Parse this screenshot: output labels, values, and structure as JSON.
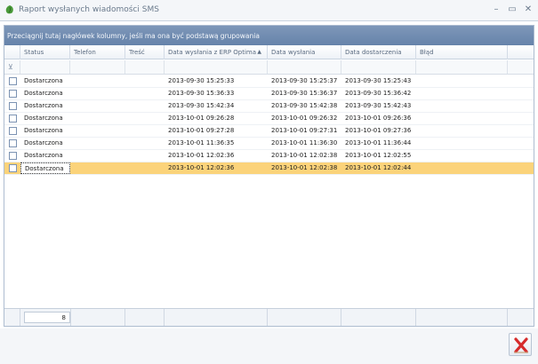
{
  "window": {
    "title": "Raport wysłanych wiadomości SMS",
    "minimize_glyph": "–",
    "maximize_glyph": "▭",
    "close_glyph": "✕"
  },
  "group_panel": {
    "text": "Przeciągnij tutaj nagłówek kolumny, jeśli ma ona być podstawą grupowania"
  },
  "columns": [
    {
      "label": "Status"
    },
    {
      "label": "Telefon"
    },
    {
      "label": "Treść"
    },
    {
      "label": "Data wysłania z ERP Optima"
    },
    {
      "label": "Data wysłania"
    },
    {
      "label": "Data dostarczenia"
    },
    {
      "label": "Błąd"
    }
  ],
  "sort_indicator": "▲",
  "filter_icon": "funnel-icon",
  "rows": [
    {
      "status": "Dostarczona",
      "telefon": "",
      "tresc": "",
      "erp": "2013-09-30 15:25:33",
      "wyslania": "2013-09-30 15:25:37",
      "dostarczenia": "2013-09-30 15:25:43",
      "blad": ""
    },
    {
      "status": "Dostarczona",
      "telefon": "",
      "tresc": "",
      "erp": "2013-09-30 15:36:33",
      "wyslania": "2013-09-30 15:36:37",
      "dostarczenia": "2013-09-30 15:36:42",
      "blad": ""
    },
    {
      "status": "Dostarczona",
      "telefon": "",
      "tresc": "",
      "erp": "2013-09-30 15:42:34",
      "wyslania": "2013-09-30 15:42:38",
      "dostarczenia": "2013-09-30 15:42:43",
      "blad": ""
    },
    {
      "status": "Dostarczona",
      "telefon": "",
      "tresc": "",
      "erp": "2013-10-01 09:26:28",
      "wyslania": "2013-10-01 09:26:32",
      "dostarczenia": "2013-10-01 09:26:36",
      "blad": ""
    },
    {
      "status": "Dostarczona",
      "telefon": "",
      "tresc": "",
      "erp": "2013-10-01 09:27:28",
      "wyslania": "2013-10-01 09:27:31",
      "dostarczenia": "2013-10-01 09:27:36",
      "blad": ""
    },
    {
      "status": "Dostarczona",
      "telefon": "",
      "tresc": "",
      "erp": "2013-10-01 11:36:35",
      "wyslania": "2013-10-01 11:36:30",
      "dostarczenia": "2013-10-01 11:36:44",
      "blad": ""
    },
    {
      "status": "Dostarczona",
      "telefon": "",
      "tresc": "",
      "erp": "2013-10-01 12:02:36",
      "wyslania": "2013-10-01 12:02:38",
      "dostarczenia": "2013-10-01 12:02:55",
      "blad": ""
    },
    {
      "status": "Dostarczona",
      "telefon": "",
      "tresc": "",
      "erp": "2013-10-01 12:02:36",
      "wyslania": "2013-10-01 12:02:38",
      "dostarczenia": "2013-10-01 12:02:44",
      "blad": ""
    }
  ],
  "footer": {
    "count": "8"
  },
  "colors": {
    "group_panel": "#6f8bb1",
    "selected_row": "#fbd37a",
    "close_red": "#d62b2b"
  }
}
